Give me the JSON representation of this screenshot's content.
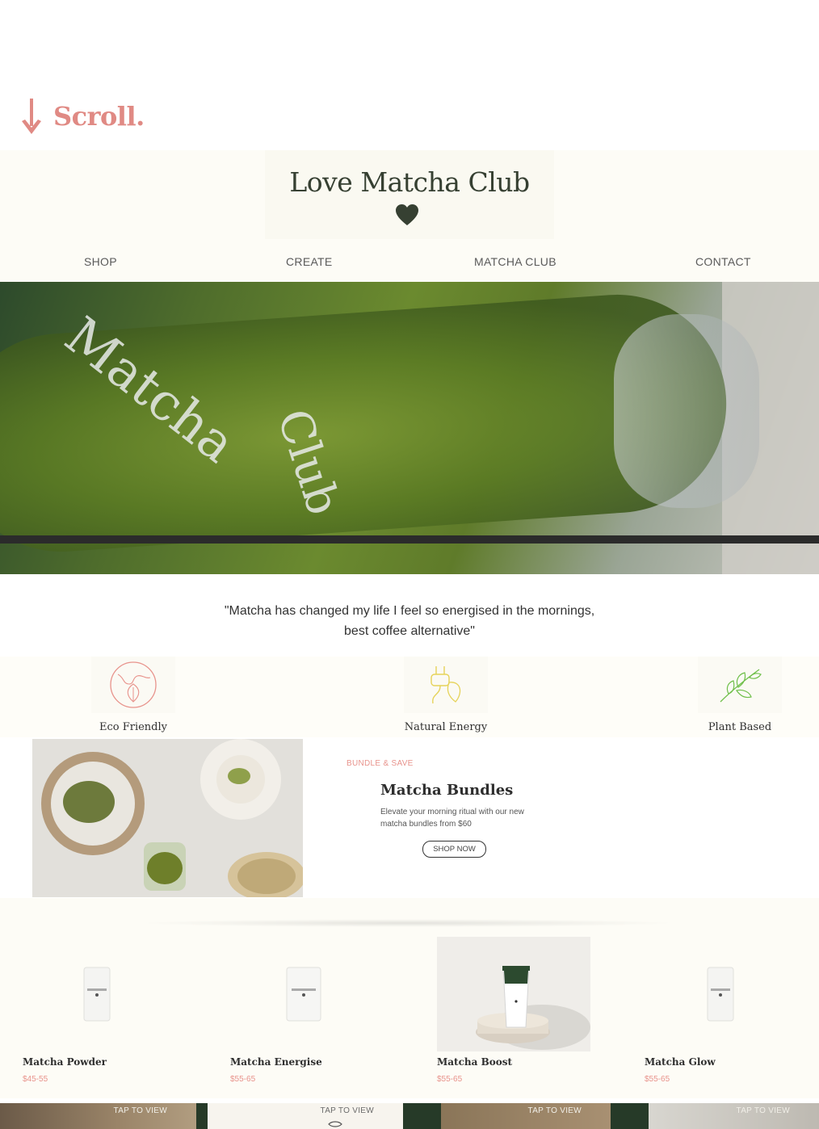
{
  "scroll_cue": {
    "label": "Scroll."
  },
  "header": {
    "logo_title": "Love Matcha Club",
    "nav": [
      {
        "label": "SHOP"
      },
      {
        "label": "CREATE"
      },
      {
        "label": "MATCHA CLUB"
      },
      {
        "label": "CONTACT"
      }
    ]
  },
  "hero": {
    "cup_text_1": "Matcha",
    "cup_text_2": "Club"
  },
  "testimonial": {
    "line1": "\"Matcha has changed my life I feel so energised in the mornings,",
    "line2": "best coffee alternative\""
  },
  "features": [
    {
      "label": "Eco Friendly",
      "icon": "globe-leaf-icon"
    },
    {
      "label": "Natural Energy",
      "icon": "energy-plug-icon"
    },
    {
      "label": "Plant Based",
      "icon": "leaf-branch-icon"
    }
  ],
  "bundle": {
    "tag": "BUNDLE & SAVE",
    "title": "Matcha Bundles",
    "description": "Elevate your morning ritual with our new matcha bundles from $60",
    "button": "SHOP NOW"
  },
  "products": [
    {
      "name": "Matcha Powder",
      "price": "$45-55"
    },
    {
      "name": "Matcha Energise",
      "price": "$55-65"
    },
    {
      "name": "Matcha Boost",
      "price": "$55-65"
    },
    {
      "name": "Matcha Glow",
      "price": "$55-65"
    }
  ],
  "tiles": [
    {
      "label": "TAP TO VIEW"
    },
    {
      "label": "TAP TO VIEW"
    },
    {
      "label": "TAP TO VIEW"
    },
    {
      "label": "TAP TO VIEW"
    }
  ],
  "colors": {
    "accent_pink": "#e08a84",
    "brand_green": "#364032",
    "cream": "#fdfcf6",
    "dark_green": "#263a28"
  }
}
